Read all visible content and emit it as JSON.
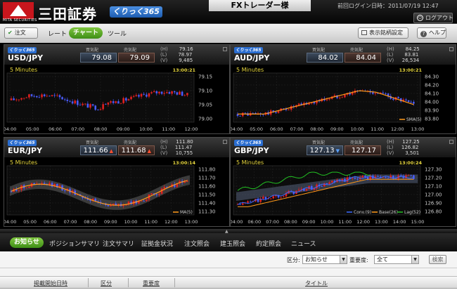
{
  "header": {
    "mark_caption": "MITA SECURITIES",
    "brand": "三田証券",
    "product": "くりっく365",
    "user_banner": "FXトレーダー様",
    "last_login": "前回ログイン日時：2011/07/19 12:47",
    "logout_label": "ログアウト"
  },
  "toolbar": {
    "order_label": "注文",
    "tabs": [
      "レート",
      "チャート",
      "ツール"
    ],
    "settings_label": "表示銘柄設定",
    "help_label": "ヘルプ"
  },
  "panel_labels": {
    "bid": "買気配",
    "ask": "売気配",
    "high": "(H)",
    "low": "(L)",
    "volume": "(V)"
  },
  "panels": [
    {
      "logo": "くりっく365",
      "pair": "USD/JPY",
      "bid": "79.08",
      "ask": "79.09",
      "bid_arrow": "",
      "ask_arrow": "",
      "high": "79.16",
      "low": "78.97",
      "volume": "9,485",
      "interval": "5 Minutes",
      "time": "13:00:21",
      "y_ticks": [
        "79.15",
        "79.10",
        "79.05",
        "79.00"
      ],
      "x_ticks": [
        "04:00",
        "05:00",
        "06:00",
        "07:00",
        "08:00",
        "09:00",
        "10:00",
        "11:00",
        "12:00"
      ],
      "legend": []
    },
    {
      "logo": "くりっく365",
      "pair": "AUD/JPY",
      "bid": "84.02",
      "ask": "84.04",
      "bid_arrow": "",
      "ask_arrow": "",
      "high": "84.25",
      "low": "83.81",
      "volume": "26,534",
      "interval": "5 Minutes",
      "time": "13:00:21",
      "y_ticks": [
        "84.30",
        "84.20",
        "84.10",
        "84.00",
        "83.90",
        "83.80"
      ],
      "x_ticks": [
        "04:00",
        "05:00",
        "06:00",
        "07:00",
        "08:00",
        "09:00",
        "10:00",
        "11:00",
        "12:00",
        "13:00"
      ],
      "legend": [
        "SMA(5)"
      ]
    },
    {
      "logo": "くりっく365",
      "pair": "EUR/JPY",
      "bid": "111.66",
      "ask": "111.68",
      "bid_arrow": "▲",
      "ask_arrow": "▲",
      "high": "111.80",
      "low": "111.47",
      "volume": "10,755",
      "interval": "5 Minutes",
      "time": "13:00:14",
      "y_ticks": [
        "111.80",
        "111.70",
        "111.60",
        "111.50",
        "111.40",
        "111.30"
      ],
      "x_ticks": [
        "04:00",
        "05:00",
        "06:00",
        "07:00",
        "08:00",
        "09:00",
        "10:00",
        "11:00",
        "12:00",
        "13:00"
      ],
      "legend": [
        "MA(5)"
      ]
    },
    {
      "logo": "くりっく365",
      "pair": "GBP/JPY",
      "bid": "127.13",
      "ask": "127.17",
      "bid_arrow": "▼",
      "ask_arrow": "",
      "high": "127.25",
      "low": "126.82",
      "volume": "3,501",
      "interval": "5 Minutes",
      "time": "13:00:24",
      "y_ticks": [
        "127.30",
        "127.20",
        "127.10",
        "127.00",
        "126.90",
        "126.80"
      ],
      "x_ticks": [
        "04:00",
        "06:00",
        "07:00",
        "08:00",
        "09:00",
        "10:00",
        "11:00",
        "12:00",
        "13:00",
        "14:00",
        "15:00"
      ],
      "legend": [
        "Conv.(9)",
        "Base(26)",
        "Lag(52)"
      ]
    }
  ],
  "colors": {
    "up_candle": "#e02020",
    "down_candle": "#4a5cff",
    "ma_line": "#ff9a1a",
    "band": "#6a6a6a",
    "conv": "#3a6aff",
    "base": "#ff9a1a",
    "lag": "#22c022",
    "cloud": "#55607a",
    "title_yellow": "#e8d840"
  },
  "bottom": {
    "tabs": [
      "お知らせ",
      "ポジションサマリ",
      "注文サマリ",
      "証拠金状況",
      "注文照会",
      "建玉照会",
      "約定照会",
      "ニュース"
    ],
    "filter_category_label": "区分:",
    "filter_category_value": "お知らせ",
    "filter_importance_label": "重要度:",
    "filter_importance_value": "全て",
    "search_label": "検索",
    "columns": [
      "掲載開始日時",
      "区分",
      "重要度",
      "タイトル"
    ]
  }
}
